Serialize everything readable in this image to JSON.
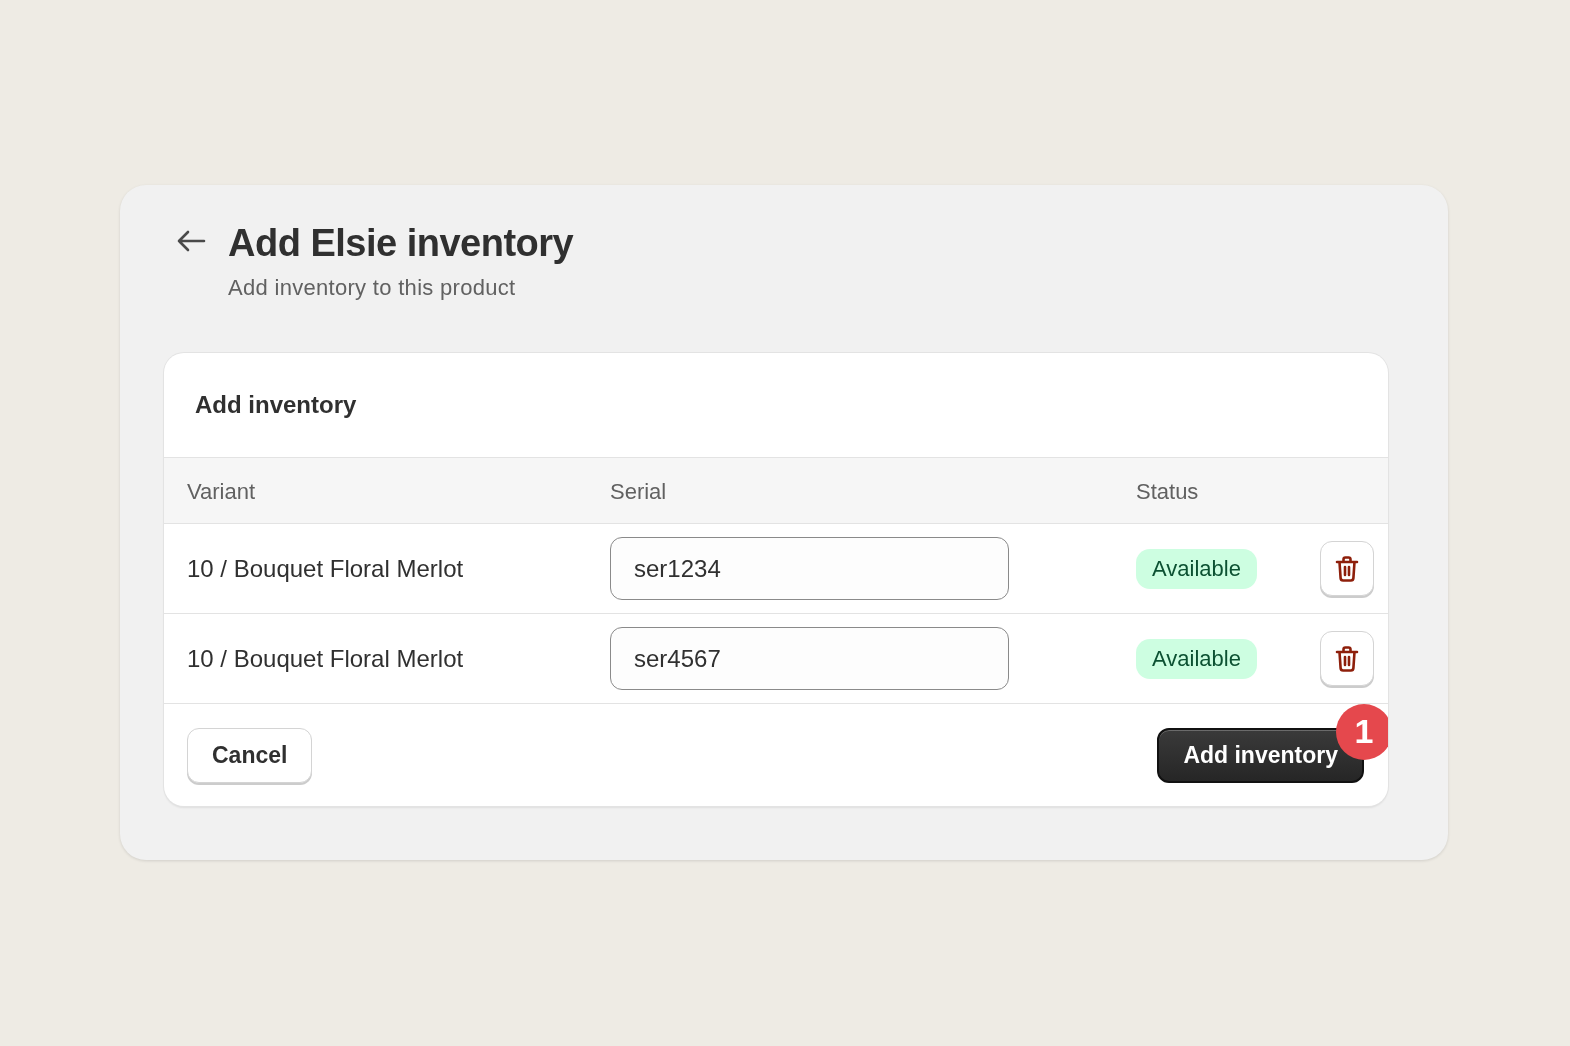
{
  "page": {
    "title": "Add Elsie inventory",
    "subtitle": "Add inventory to this product"
  },
  "card": {
    "title": "Add inventory"
  },
  "table": {
    "columns": [
      "Variant",
      "Serial",
      "Status"
    ],
    "rows": [
      {
        "variant": "10 / Bouquet Floral Merlot",
        "serial": "ser1234",
        "status": "Available"
      },
      {
        "variant": "10 / Bouquet Floral Merlot",
        "serial": "ser4567",
        "status": "Available"
      }
    ]
  },
  "footer": {
    "buttons": [
      {
        "kind": "secondary",
        "label": "Cancel"
      },
      {
        "kind": "primary",
        "label": "Add inventory",
        "badge": "1"
      }
    ]
  }
}
